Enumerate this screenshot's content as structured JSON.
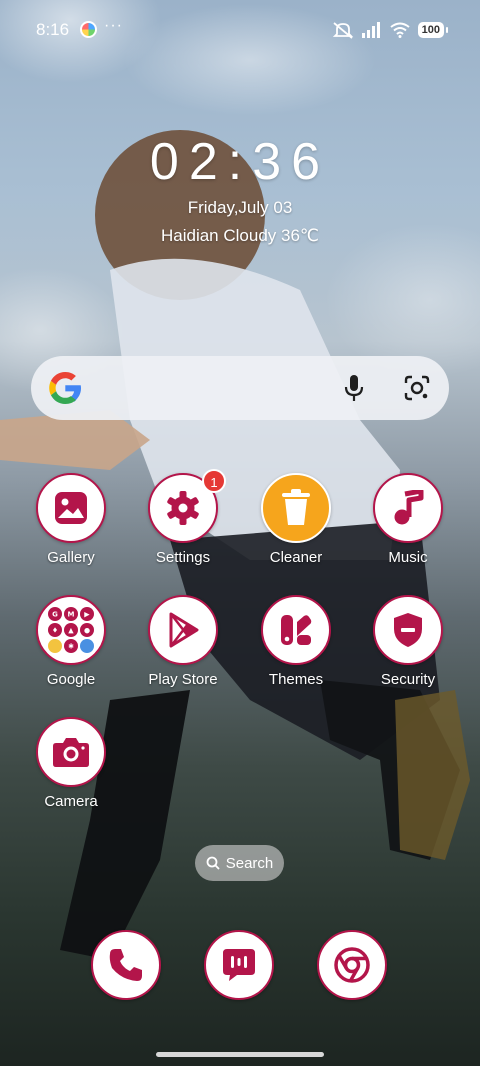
{
  "status_bar": {
    "time": "8:16",
    "dots": "···",
    "battery": "100"
  },
  "clock": {
    "time": "02:36",
    "date": "Friday,July 03",
    "weather": "Haidian Cloudy 36℃"
  },
  "search_widget": {
    "icons": [
      "google-g-icon",
      "microphone-icon",
      "google-lens-icon"
    ]
  },
  "apps": [
    {
      "label": "Gallery",
      "icon": "gallery-icon"
    },
    {
      "label": "Settings",
      "icon": "gear-icon",
      "badge": "1"
    },
    {
      "label": "Cleaner",
      "icon": "trash-icon"
    },
    {
      "label": "Music",
      "icon": "music-note-icon"
    },
    {
      "label": "Google",
      "icon": "folder-icon"
    },
    {
      "label": "Play Store",
      "icon": "play-store-icon"
    },
    {
      "label": "Themes",
      "icon": "themes-icon"
    },
    {
      "label": "Security",
      "icon": "shield-icon"
    },
    {
      "label": "Camera",
      "icon": "camera-icon"
    }
  ],
  "search_pill": {
    "label": "Search"
  },
  "dock": [
    "phone-icon",
    "messages-icon",
    "chrome-icon"
  ],
  "colors": {
    "accent": "#b3154a",
    "cleaner": "#f6a51c",
    "badge": "#e53935"
  }
}
